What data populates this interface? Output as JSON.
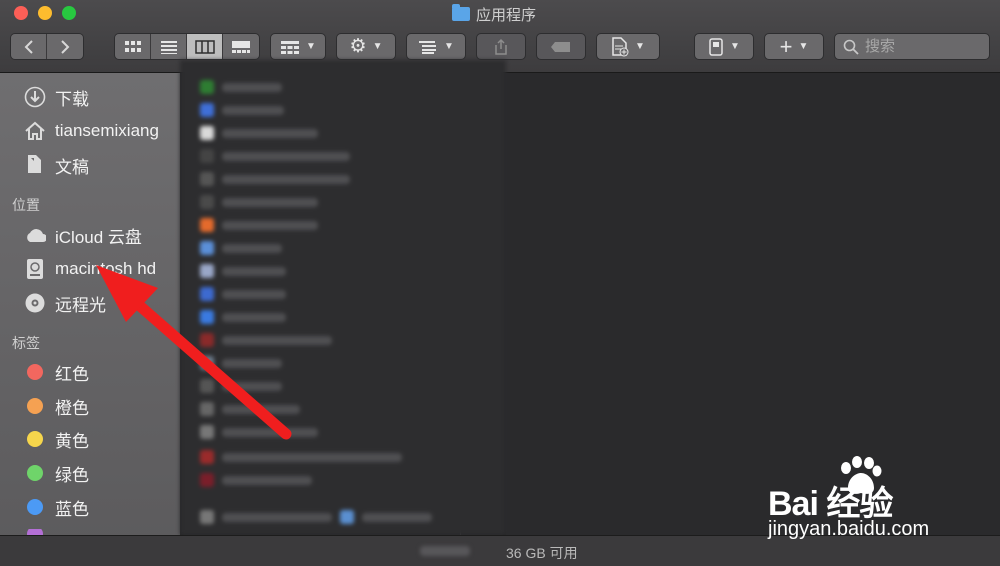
{
  "window": {
    "title": "应用程序"
  },
  "toolbar": {
    "back_icon": "chevron-left-icon",
    "forward_icon": "chevron-right-icon",
    "view_modes": [
      "icon-view",
      "list-view",
      "column-view",
      "gallery-view"
    ],
    "active_view": "column-view"
  },
  "search": {
    "placeholder": "搜索"
  },
  "sidebar": {
    "favorites": [
      {
        "label": "下载",
        "icon": "download-icon"
      },
      {
        "label": "tiansemixiang",
        "icon": "home-icon"
      },
      {
        "label": "文稿",
        "icon": "documents-icon"
      }
    ],
    "locations_header": "位置",
    "locations": [
      {
        "label": "iCloud 云盘",
        "icon": "cloud-icon"
      },
      {
        "label": "macintosh hd",
        "icon": "harddisk-icon"
      },
      {
        "label": "远程光",
        "icon": "disc-icon"
      }
    ],
    "tags_header": "标签",
    "tags": [
      {
        "label": "红色",
        "color": "#f2675f"
      },
      {
        "label": "橙色",
        "color": "#f5a152"
      },
      {
        "label": "黄色",
        "color": "#f6d64c"
      },
      {
        "label": "绿色",
        "color": "#6fd46a"
      },
      {
        "label": "蓝色",
        "color": "#4c9af5"
      }
    ]
  },
  "status": {
    "text": "36 GB 可用"
  },
  "watermark": {
    "brand": "Bai 经验",
    "url": "jingyan.baidu.com"
  },
  "colors": {
    "arrow": "#f01e1e"
  }
}
